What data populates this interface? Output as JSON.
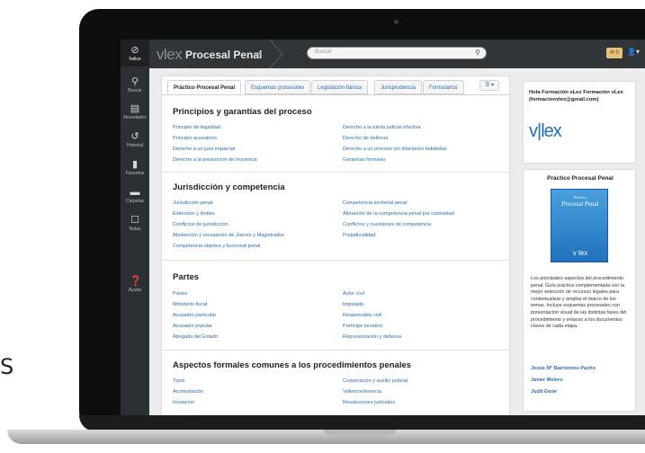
{
  "app": {
    "logo": "vlex",
    "title": "Procesal Penal",
    "search_placeholder": "Buscar",
    "notifications": "0"
  },
  "rail": [
    {
      "label": "Índice",
      "icon": "compass-icon"
    },
    {
      "label": "Buscar",
      "icon": "search-icon"
    },
    {
      "label": "Novedades",
      "icon": "newspaper-icon"
    },
    {
      "label": "Historial",
      "icon": "history-icon"
    },
    {
      "label": "Favoritos",
      "icon": "bookmark-icon"
    },
    {
      "label": "Carpetas",
      "icon": "folder-icon"
    },
    {
      "label": "Notas",
      "icon": "note-icon"
    },
    {
      "label": "Ayuda",
      "icon": "help-icon"
    }
  ],
  "tabs": [
    "Práctico Procesal Penal",
    "Esquemas procesales",
    "Legislación básica",
    "Jurisprudencia",
    "Formularios"
  ],
  "sections": [
    {
      "title": "Principios y garantías del proceso",
      "left": [
        "Principio de legalidad",
        "Principio acusatorio",
        "Derecho a un juez imparcial",
        "Derecho a la presunción de inocencia"
      ],
      "right": [
        "Derecho a la tutela judicial efectiva",
        "Derecho de defensa",
        "Derecho a un proceso sin dilaciones indebidas",
        "Garantías formales"
      ]
    },
    {
      "title": "Jurisdicción y competencia",
      "left": [
        "Jurisdicción penal",
        "Extensión y límites",
        "Conflictos de jurisdicción",
        "Abstención y recusación de Jueces y Magistrados",
        "Competencia objetiva y funcional penal"
      ],
      "right": [
        "Competencia territorial penal",
        "Alteración de la competencia penal por conexidad",
        "Conflictos y cuestiones de competencia",
        "Prejudicialidad"
      ]
    },
    {
      "title": "Partes",
      "left": [
        "Partes",
        "Ministerio fiscal",
        "Acusador particular",
        "Acusador popular",
        "Abogado del Estado"
      ],
      "right": [
        "Actor civil",
        "Imputado",
        "Responsable civil",
        "Partícipe lucrativo",
        "Representación y defensa"
      ]
    },
    {
      "title": "Aspectos formales comunes a los procedimientos penales",
      "left": [
        "Tipos",
        "Acomodación",
        "Incoación"
      ],
      "right": [
        "Cooperación y auxilio judicial",
        "Videoconferencia",
        "Resoluciones judiciales"
      ]
    }
  ],
  "sidebar": {
    "greeting": "Hola Formación vLex Formación vLex (formacionvlex@gmail.com)",
    "logo": "v|lex",
    "product_title": "Práctico Procesal Penal",
    "book_line1": "Práctico",
    "book_line2": "Procesal Penal",
    "book_logo": "v lex",
    "description": "Los principales aspectos del procedimiento penal. Guía práctica complementada con la mejor selección de recursos legales para contextualizar y ampliar el marco de los temas. Incluye esquemas procesales con presentación visual de las distintas fases del procedimiento y enlaces a los documentos claves de cada etapa.",
    "authors": [
      "Jesús Mª Barrientos Pacho",
      "Javier Melero",
      "Judit Gené"
    ]
  },
  "colors": {
    "link": "#2a6cb0",
    "rail": "#2c2f33",
    "topbar": "#323538",
    "accent": "#1d6fb5"
  }
}
